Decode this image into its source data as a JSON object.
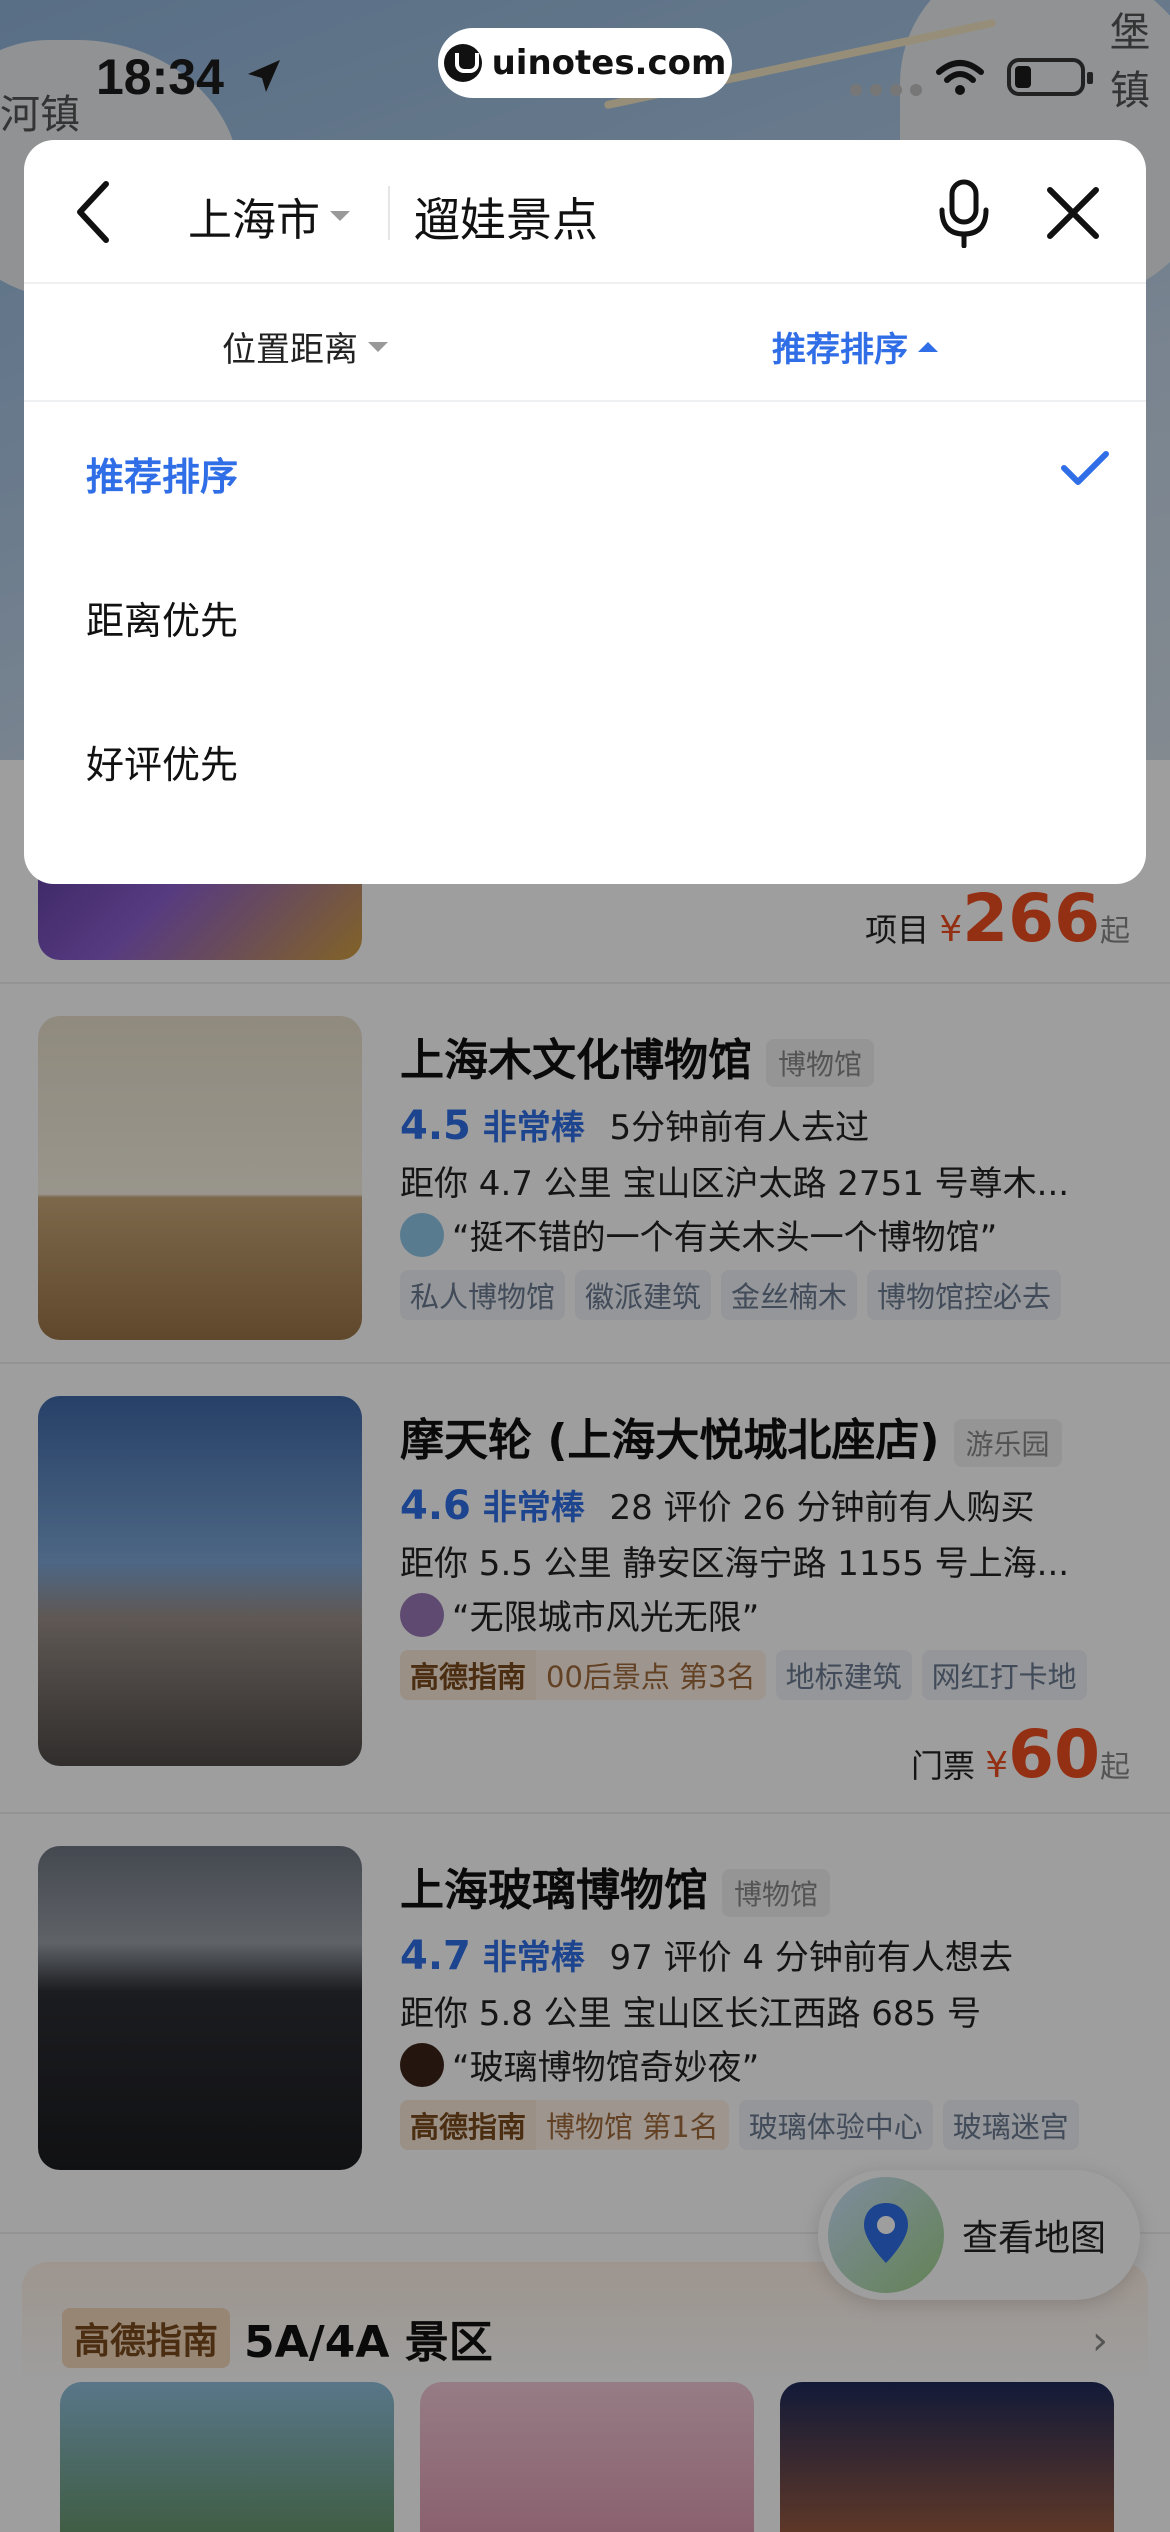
{
  "status_bar": {
    "time": "18:34",
    "url": "uinotes.com"
  },
  "map": {
    "labels": [
      "河镇",
      "堡镇"
    ]
  },
  "search": {
    "city": "上海市",
    "query": "遛娃景点"
  },
  "filters": {
    "distance_label": "位置距离",
    "sort_label": "推荐排序"
  },
  "sort_options": [
    {
      "label": "推荐排序",
      "selected": true
    },
    {
      "label": "距离优先",
      "selected": false
    },
    {
      "label": "好评优先",
      "selected": false
    }
  ],
  "results": [
    {
      "price_prefix": "项目",
      "price_currency": "¥",
      "price": "266",
      "price_suffix": "起"
    },
    {
      "title": "上海木文化博物馆",
      "category": "博物馆",
      "rating": "4.5",
      "rating_text": "非常棒",
      "activity": "5分钟前有人去过",
      "address": "距你 4.7 公里   宝山区沪太路 2751 号尊木...",
      "quote": "“挺不错的一个有关木头一个博物馆”",
      "tags": [
        "私人博物馆",
        "徽派建筑",
        "金丝楠木",
        "博物馆控必去"
      ]
    },
    {
      "title": "摩天轮 (上海大悦城北座店)",
      "category": "游乐园",
      "rating": "4.6",
      "rating_text": "非常棒",
      "activity": "28 评价   26 分钟前有人购买",
      "address": "距你 5.5 公里   静安区海宁路 1155 号上海...",
      "quote": "“无限城市风光无限”",
      "guide_badge": "高德指南",
      "guide_rank": "00后景点  第3名",
      "tags": [
        "地标建筑",
        "网红打卡地"
      ],
      "price_prefix": "门票",
      "price_currency": "¥",
      "price": "60",
      "price_suffix": "起"
    },
    {
      "title": "上海玻璃博物馆",
      "category": "博物馆",
      "rating": "4.7",
      "rating_text": "非常棒",
      "activity": "97 评价   4 分钟前有人想去",
      "address": "距你 5.8 公里   宝山区长江西路 685 号",
      "quote": "“玻璃博物馆奇妙夜”",
      "guide_badge": "高德指南",
      "guide_rank": "博物馆  第1名",
      "tags": [
        "玻璃体验中心",
        "玻璃迷宫"
      ]
    }
  ],
  "map_button": {
    "label": "查看地图"
  },
  "section": {
    "badge": "高德指南",
    "title": "5A/4A 景区"
  },
  "colors": {
    "accent": "#2f6ee6",
    "price": "#ee4d1e"
  }
}
